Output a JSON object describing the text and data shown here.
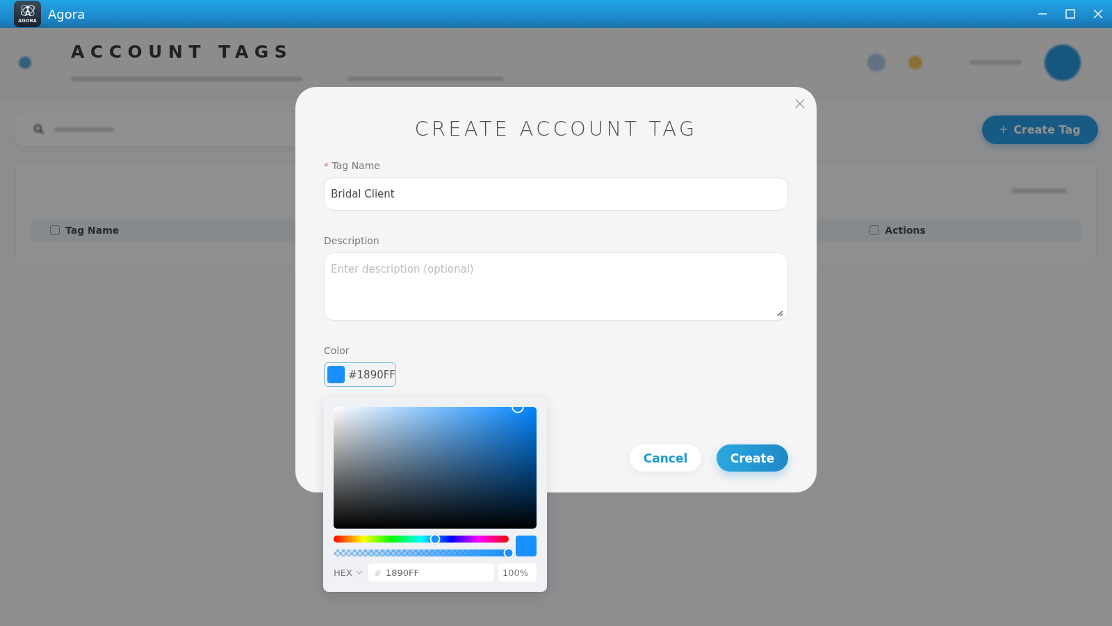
{
  "window": {
    "title": "Agora",
    "logo_text": "AGORA"
  },
  "background_page": {
    "title": "ACCOUNT TAGS",
    "create_button": "Create Tag",
    "table": {
      "columns": [
        "Tag Name",
        "Actions"
      ]
    }
  },
  "dialog": {
    "title": "CREATE ACCOUNT TAG",
    "fields": [
      {
        "kind": "text",
        "label": "Tag Name",
        "required_mark": "*",
        "value": "Bridal Client"
      },
      {
        "kind": "textarea",
        "label": "Description",
        "placeholder": "Enter description (optional)"
      },
      {
        "kind": "color",
        "label": "Color",
        "value": "#1890FF",
        "picker": {
          "sliders": [
            {
              "kind": "hue",
              "level": 0.58
            },
            {
              "kind": "alpha",
              "level": 1
            }
          ],
          "format": "HEX",
          "hex_prefix": "#",
          "hex_value": "1890FF",
          "alpha_value": "100%"
        }
      }
    ],
    "buttons": [
      {
        "kind": "secondary",
        "label": "Cancel"
      },
      {
        "kind": "primary",
        "label": "Create"
      }
    ]
  }
}
